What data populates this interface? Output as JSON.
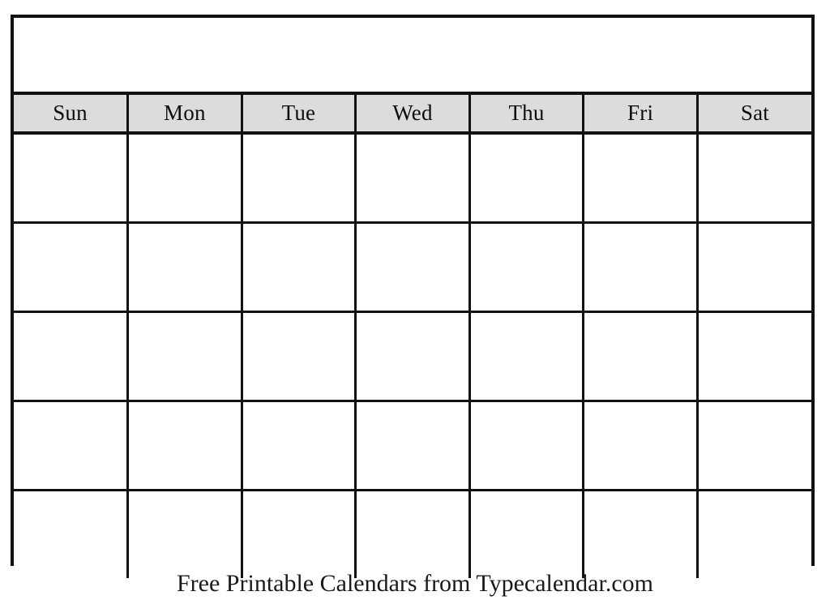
{
  "document": {
    "type": "printable-blank-calendar",
    "background_color": "#FFFFFF"
  },
  "calendar": {
    "title": "",
    "header_background_color": "#DCDCDC",
    "border_color": "#111111",
    "cell_background_color": "#FFFFFF",
    "weekday_headers": [
      {
        "short": "Sun"
      },
      {
        "short": "Mon"
      },
      {
        "short": "Tue"
      },
      {
        "short": "Wed"
      },
      {
        "short": "Thu"
      },
      {
        "short": "Fri"
      },
      {
        "short": "Sat"
      }
    ],
    "weeks": [
      {
        "days": [
          "",
          "",
          "",
          "",
          "",
          "",
          ""
        ]
      },
      {
        "days": [
          "",
          "",
          "",
          "",
          "",
          "",
          ""
        ]
      },
      {
        "days": [
          "",
          "",
          "",
          "",
          "",
          "",
          ""
        ]
      },
      {
        "days": [
          "",
          "",
          "",
          "",
          "",
          "",
          ""
        ]
      },
      {
        "days": [
          "",
          "",
          "",
          "",
          "",
          "",
          ""
        ]
      }
    ]
  },
  "footer": {
    "text": "Free Printable Calendars from Typecalendar.com"
  }
}
